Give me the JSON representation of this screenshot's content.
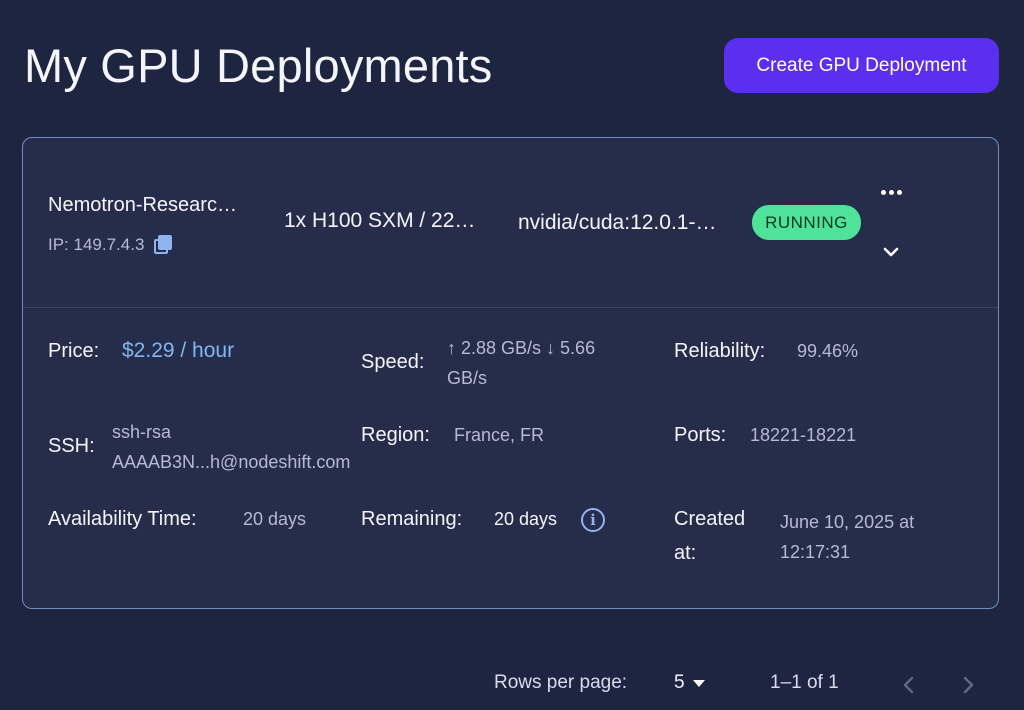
{
  "page": {
    "title": "My GPU Deployments",
    "create_button": "Create GPU Deployment"
  },
  "deployment": {
    "name": "Nemotron-Researc…",
    "ip": "IP: 149.7.4.3",
    "gpu": "1x H100 SXM / 22…",
    "image": "nvidia/cuda:12.0.1-…",
    "status": "RUNNING",
    "details": {
      "price_label": "Price:",
      "price_value": "$2.29 / hour",
      "speed_label": "Speed:",
      "speed_line1": "↑ 2.88 GB/s ↓ 5.66",
      "speed_line2": "GB/s",
      "reliability_label": "Reliability:",
      "reliability_value": "99.46%",
      "ssh_label": "SSH:",
      "ssh_line1": "ssh-rsa",
      "ssh_line2": "AAAAB3N...h@nodeshift.com",
      "region_label": "Region:",
      "region_value": "France, FR",
      "ports_label": "Ports:",
      "ports_value": "18221-18221",
      "availability_label": "Availability Time:",
      "availability_value": "20 days",
      "remaining_label": "Remaining:",
      "remaining_value": "20 days",
      "created_label_line1": "Created",
      "created_label_line2": "at:",
      "created_line1": "June 10, 2025 at",
      "created_line2": "12:17:31"
    }
  },
  "pagination": {
    "rows_label": "Rows per page:",
    "rows_value": "5",
    "range": "1–1 of 1"
  },
  "icons": {
    "copy": "copy-icon",
    "more": "more-horizontal-icon",
    "expand": "chevron-down-icon",
    "info": "info-icon",
    "prev": "chevron-left-icon",
    "next": "chevron-right-icon"
  },
  "colors": {
    "background": "#1e2540",
    "card": "#262d4a",
    "accent": "#5b2ef0",
    "status_running": "#4fe39a",
    "price": "#7fb7f2"
  }
}
